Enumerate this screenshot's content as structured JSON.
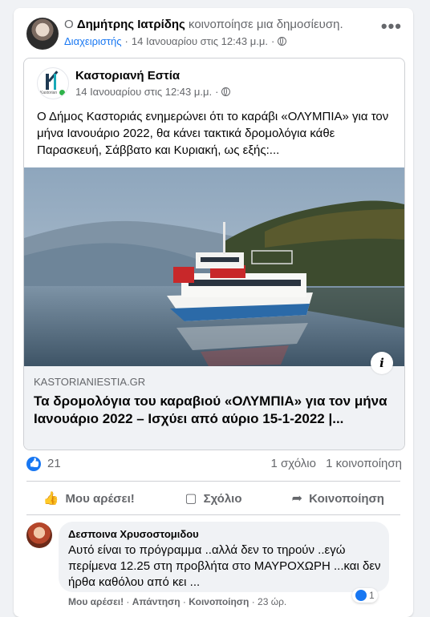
{
  "header": {
    "prefix": "Ο",
    "author": "Δημήτρης Ιατρίδης",
    "action": "κοινοποίησε μια δημοσίευση.",
    "role": "Διαχειριστής",
    "separator": "·",
    "time": "14 Ιανουαρίου στις 12:43 μ.μ.",
    "separator2": "·",
    "more_icon": "ellipsis-icon",
    "more_label": "•••"
  },
  "shared_post": {
    "page_name": "Καστοριανή Εστία",
    "logo_tiny_text": "Kastorian",
    "time": "14 Ιανουαρίου στις 12:43 μ.μ.",
    "separator": "·",
    "text": "Ο Δήμος Καστοριάς ενημερώνει ότι το καράβι «ΟΛΥΜΠΙΑ» για τον μήνα Ιανουάριο 2022, θα κάνει τακτικά δρομολόγια κάθε Παρασκευή, Σάββατο και Κυριακή, ως εξής:...",
    "ship_name": "ΟΛΥΜΠΙΑ",
    "link": {
      "domain": "KASTORIANIESTIA.GR",
      "title": "Τα δρομολόγια του καραβιού «ΟΛΥΜΠΙΑ» για τον μήνα Ιανουάριο 2022 – Ισχύει από αύριο 15-1-2022 |...",
      "info_label": "i"
    }
  },
  "stats": {
    "likes": "21",
    "comments": "1 σχόλιο",
    "shares": "1 κοινοποίηση"
  },
  "actions": {
    "like": "Μου αρέσει!",
    "comment": "Σχόλιο",
    "share": "Κοινοποίηση",
    "like_glyph": "👍",
    "comment_glyph": "▢",
    "share_glyph": "➦"
  },
  "comment": {
    "author": "Δεσποινα Χρυσοστομιδου",
    "text": "Αυτό είναι το πρόγραμμα ..αλλά δεν το τηρούν ..εγώ περίμενα 12.25 στη προβλήτα στο ΜΑΥΡΟΧΩΡΗ ...και δεν ήρθα καθόλου από κει ...",
    "reaction_count": "1",
    "like_action": "Μου αρέσει!",
    "sep1": " · ",
    "reply_action": "Απάντηση",
    "sep2": " · ",
    "share_action": "Κοινοποίηση",
    "sep3": " · ",
    "age": "23 ώρ."
  }
}
